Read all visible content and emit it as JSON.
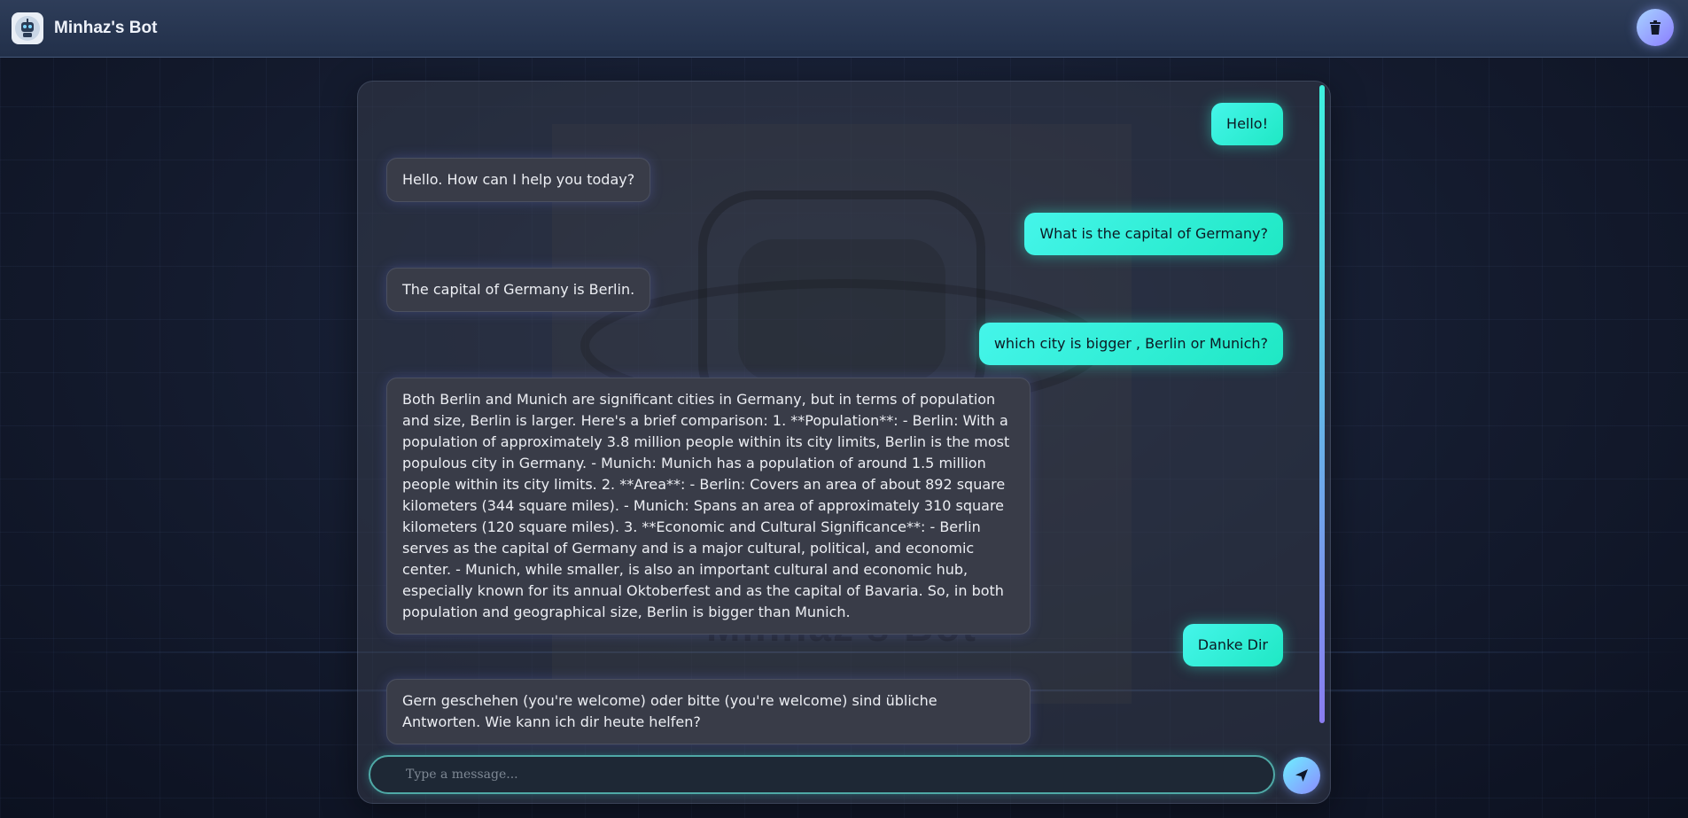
{
  "header": {
    "title": "Minhaz's Bot",
    "logo_icon": "robot-logo-icon",
    "clear_icon": "trash-icon"
  },
  "watermark": {
    "text": "Minhaz's Bot"
  },
  "messages": [
    {
      "role": "user",
      "text": "Hello!"
    },
    {
      "role": "bot",
      "text": "Hello. How can I help you today?"
    },
    {
      "role": "user",
      "text": "What is the capital of Germany?"
    },
    {
      "role": "bot",
      "text": "The capital of Germany is Berlin."
    },
    {
      "role": "user",
      "text": "which city is bigger , Berlin or Munich?"
    },
    {
      "role": "bot",
      "text": "Both Berlin and Munich are significant cities in Germany, but in terms of population and size, Berlin is larger. Here's a brief comparison: 1. **Population**: - Berlin: With a population of approximately 3.8 million people within its city limits, Berlin is the most populous city in Germany. - Munich: Munich has a population of around 1.5 million people within its city limits. 2. **Area**: - Berlin: Covers an area of about 892 square kilometers (344 square miles). - Munich: Spans an area of approximately 310 square kilometers (120 square miles). 3. **Economic and Cultural Significance**: - Berlin serves as the capital of Germany and is a major cultural, political, and economic center. - Munich, while smaller, is also an important cultural and economic hub, especially known for its annual Oktoberfest and as the capital of Bavaria. So, in both population and geographical size, Berlin is bigger than Munich."
    },
    {
      "role": "user",
      "text": "Danke Dir"
    },
    {
      "role": "bot",
      "text": "Gern geschehen (you're welcome) oder bitte (you're welcome) sind übliche Antworten. Wie kann ich dir heute helfen?"
    }
  ],
  "input": {
    "placeholder": "Type a message...",
    "value": "",
    "send_icon": "send-icon"
  },
  "colors": {
    "accent": "#2ef0d0",
    "user_bubble": "#45f5ea",
    "bot_bubble": "#393c48",
    "header_bg": "#2e3d59"
  }
}
